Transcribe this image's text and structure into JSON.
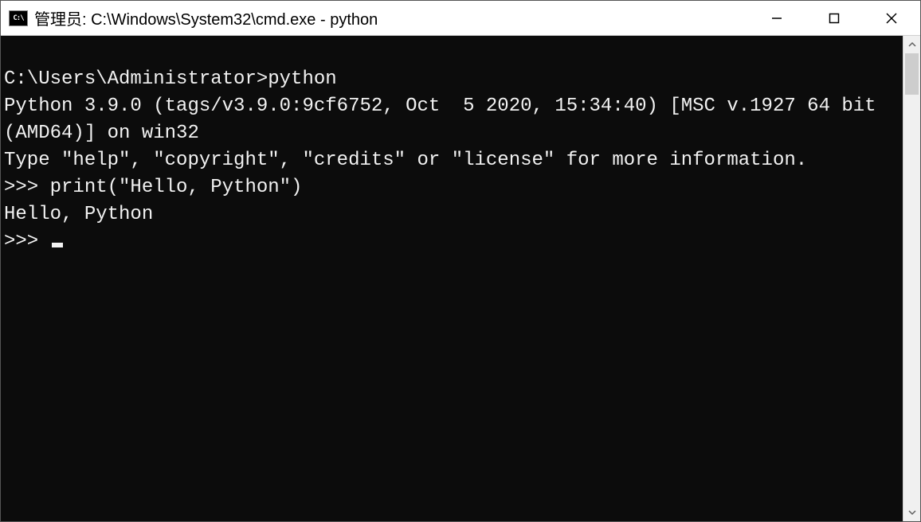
{
  "window": {
    "icon_label": "C:\\",
    "title": "管理员: C:\\Windows\\System32\\cmd.exe - python"
  },
  "terminal": {
    "lines": [
      "",
      "C:\\Users\\Administrator>python",
      "Python 3.9.0 (tags/v3.9.0:9cf6752, Oct  5 2020, 15:34:40) [MSC v.1927 64 bit (AMD64)] on win32",
      "Type \"help\", \"copyright\", \"credits\" or \"license\" for more information.",
      ">>> print(\"Hello, Python\")",
      "Hello, Python"
    ],
    "prompt": ">>> "
  }
}
